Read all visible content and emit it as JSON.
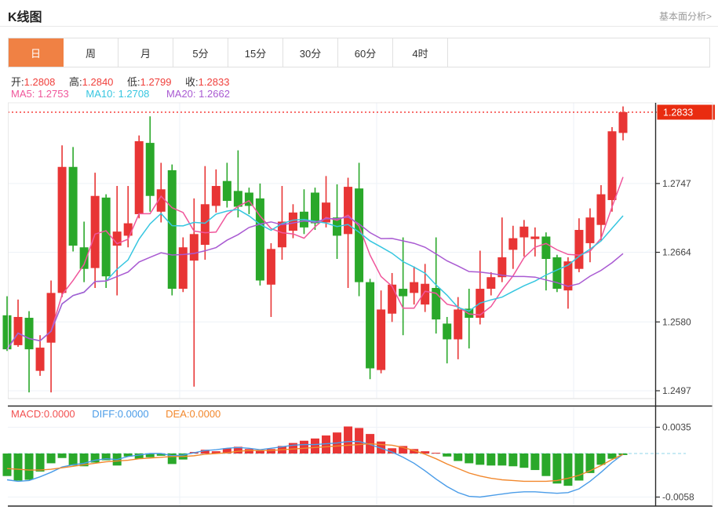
{
  "header": {
    "title": "K线图",
    "link": "基本面分析>"
  },
  "tabs": {
    "items": [
      "日",
      "周",
      "月",
      "5分",
      "15分",
      "30分",
      "60分",
      "4时"
    ],
    "active": "日"
  },
  "quote": {
    "open_label": "开:",
    "open": "1.2808",
    "high_label": "高:",
    "high": "1.2840",
    "low_label": "低:",
    "low": "1.2799",
    "close_label": "收:",
    "close": "1.2833"
  },
  "ma_header": {
    "ma5_label": "MA5:",
    "ma5": "1.2753",
    "ma10_label": "MA10:",
    "ma10": "1.2708",
    "ma20_label": "MA20:",
    "ma20": "1.2662"
  },
  "macd_header": {
    "macd_label": "MACD:",
    "macd": "0.0000",
    "diff_label": "DIFF:",
    "diff": "0.0000",
    "dea_label": "DEA:",
    "dea": "0.0000"
  },
  "colors": {
    "up": "#e83535",
    "down": "#2aa82a",
    "ma5": "#f0569b",
    "ma10": "#36c6e0",
    "ma20": "#a95ad2",
    "diff_line": "#4a9ce8",
    "dea_line": "#f2882d",
    "tag_bg": "#e92c10",
    "tag_text": "#ffffff",
    "grid": "#eef2f7",
    "axis": "#2a2a2a",
    "dotted_price_line": "#f5413d",
    "zero_dash": "#8fd4e8",
    "active_tab": "#f08144"
  },
  "chart_data": {
    "type": "candlestick",
    "title": "K线图 daily candlestick with MA5/MA10/MA20 and MACD",
    "legend": [
      "MA5",
      "MA10",
      "MA20"
    ],
    "price_axis": {
      "current": 1.2833,
      "current_label": "1.2833",
      "ticks": [
        1.2747,
        1.2664,
        1.258,
        1.2497
      ],
      "tick_labels": [
        "1.2747",
        "1.2664",
        "1.2580",
        "1.2497"
      ],
      "max": 1.2833,
      "min": 1.2497
    },
    "candles": [
      [
        1.2588,
        1.2611,
        1.2545,
        1.2547
      ],
      [
        1.2552,
        1.2607,
        1.255,
        1.2586
      ],
      [
        1.2585,
        1.2593,
        1.2495,
        1.2547
      ],
      [
        1.2521,
        1.2564,
        1.2515,
        1.2549
      ],
      [
        1.2555,
        1.263,
        1.2495,
        1.2615
      ],
      [
        1.2615,
        1.2793,
        1.261,
        1.2767
      ],
      [
        1.2767,
        1.2791,
        1.2665,
        1.2672
      ],
      [
        1.267,
        1.2701,
        1.2628,
        1.2644
      ],
      [
        1.2645,
        1.276,
        1.2621,
        1.2732
      ],
      [
        1.273,
        1.2734,
        1.2621,
        1.2635
      ],
      [
        1.2672,
        1.2744,
        1.2612,
        1.2689
      ],
      [
        1.2684,
        1.2744,
        1.267,
        1.2699
      ],
      [
        1.271,
        1.2805,
        1.2705,
        1.2798
      ],
      [
        1.2796,
        1.2828,
        1.2713,
        1.2732
      ],
      [
        1.2713,
        1.2772,
        1.27,
        1.274
      ],
      [
        1.2763,
        1.277,
        1.2612,
        1.262
      ],
      [
        1.262,
        1.2682,
        1.2616,
        1.267
      ],
      [
        1.2654,
        1.2729,
        1.2502,
        1.2686
      ],
      [
        1.2673,
        1.2768,
        1.2655,
        1.2722
      ],
      [
        1.272,
        1.2764,
        1.2712,
        1.2744
      ],
      [
        1.275,
        1.2772,
        1.2718,
        1.2726
      ],
      [
        1.2738,
        1.2787,
        1.2706,
        1.2719
      ],
      [
        1.2736,
        1.2742,
        1.271,
        1.272
      ],
      [
        1.2729,
        1.2747,
        1.2624,
        1.263
      ],
      [
        1.2625,
        1.2675,
        1.2586,
        1.2668
      ],
      [
        1.267,
        1.2744,
        1.2655,
        1.2701
      ],
      [
        1.269,
        1.2722,
        1.2681,
        1.2712
      ],
      [
        1.2713,
        1.274,
        1.2686,
        1.2694
      ],
      [
        1.2736,
        1.2742,
        1.2691,
        1.2699
      ],
      [
        1.27,
        1.2756,
        1.2694,
        1.2724
      ],
      [
        1.2706,
        1.2746,
        1.2656,
        1.2684
      ],
      [
        1.2686,
        1.2754,
        1.2621,
        1.2743
      ],
      [
        1.2741,
        1.2772,
        1.2611,
        1.2628
      ],
      [
        1.2628,
        1.2632,
        1.2511,
        1.2524
      ],
      [
        1.2522,
        1.2618,
        1.2518,
        1.2595
      ],
      [
        1.259,
        1.2639,
        1.258,
        1.2625
      ],
      [
        1.262,
        1.2682,
        1.2564,
        1.2611
      ],
      [
        1.2615,
        1.2647,
        1.2601,
        1.2628
      ],
      [
        1.2601,
        1.265,
        1.2592,
        1.2626
      ],
      [
        1.2621,
        1.2682,
        1.2566,
        1.2583
      ],
      [
        1.2578,
        1.2586,
        1.253,
        1.2559
      ],
      [
        1.2559,
        1.261,
        1.2535,
        1.2595
      ],
      [
        1.2596,
        1.262,
        1.2548,
        1.2585
      ],
      [
        1.2585,
        1.2666,
        1.2577,
        1.262
      ],
      [
        1.262,
        1.264,
        1.2612,
        1.2634
      ],
      [
        1.2634,
        1.2706,
        1.2628,
        1.2658
      ],
      [
        1.2667,
        1.2696,
        1.2644,
        1.2681
      ],
      [
        1.2682,
        1.2703,
        1.2659,
        1.2695
      ],
      [
        1.268,
        1.2694,
        1.2659,
        1.2683
      ],
      [
        1.2683,
        1.2688,
        1.2618,
        1.2656
      ],
      [
        1.2658,
        1.2661,
        1.2616,
        1.262
      ],
      [
        1.2618,
        1.2658,
        1.2596,
        1.2653
      ],
      [
        1.2644,
        1.2705,
        1.264,
        1.2691
      ],
      [
        1.2675,
        1.2717,
        1.2652,
        1.2706
      ],
      [
        1.2697,
        1.2745,
        1.2678,
        1.2734
      ],
      [
        1.2727,
        1.2815,
        1.2713,
        1.281
      ],
      [
        1.2808,
        1.284,
        1.2799,
        1.2833
      ]
    ],
    "ma_periods": [
      5,
      10,
      20
    ],
    "macd": {
      "axis_ticks": [
        0.0035,
        -0.0058
      ],
      "axis_labels": [
        "0.0035",
        "-0.0058"
      ],
      "hist": [
        -0.003,
        -0.0036,
        -0.0035,
        -0.0024,
        -0.0013,
        -0.0006,
        -0.0016,
        -0.0017,
        -0.0012,
        -0.0009,
        -0.0016,
        -0.0004,
        -0.0007,
        -0.0005,
        -0.0003,
        -0.0014,
        -0.0008,
        0.0002,
        0.0005,
        0.0003,
        0.0007,
        0.0009,
        0.0006,
        0.0004,
        0.0006,
        0.001,
        0.0014,
        0.0017,
        0.002,
        0.0024,
        0.0028,
        0.0036,
        0.0034,
        0.0026,
        0.0016,
        0.0007,
        0.001,
        0.0006,
        0.0003,
        0.0001,
        -0.0004,
        -0.001,
        -0.0013,
        -0.0015,
        -0.0016,
        -0.0016,
        -0.0017,
        -0.0019,
        -0.0022,
        -0.003,
        -0.004,
        -0.0043,
        -0.0036,
        -0.0026,
        -0.0015,
        -0.0007,
        -0.0002
      ],
      "diff": [
        -0.0035,
        -0.0037,
        -0.0036,
        -0.0031,
        -0.0025,
        -0.0018,
        -0.0015,
        -0.0013,
        -0.0009,
        -0.0007,
        -0.0008,
        -0.0004,
        -0.0002,
        0.0,
        0.0,
        -0.0003,
        -0.0002,
        0.0001,
        0.0004,
        0.0005,
        0.0007,
        0.0008,
        0.0007,
        0.0005,
        0.0007,
        0.0009,
        0.0011,
        0.0012,
        0.0012,
        0.0013,
        0.0014,
        0.0016,
        0.0016,
        0.0012,
        0.0007,
        0.0002,
        -0.0005,
        -0.0013,
        -0.0023,
        -0.0034,
        -0.0044,
        -0.0052,
        -0.0057,
        -0.0058,
        -0.0056,
        -0.0054,
        -0.0052,
        -0.0051,
        -0.0051,
        -0.0052,
        -0.0053,
        -0.0052,
        -0.0047,
        -0.0037,
        -0.0025,
        -0.0012,
        -0.0001
      ],
      "dea": [
        -0.002,
        -0.0021,
        -0.0022,
        -0.0022,
        -0.0021,
        -0.0019,
        -0.0017,
        -0.0015,
        -0.0013,
        -0.0011,
        -0.001,
        -0.0009,
        -0.0007,
        -0.0006,
        -0.0005,
        -0.0004,
        -0.0004,
        -0.0003,
        -0.0001,
        0.0,
        0.0001,
        0.0003,
        0.0004,
        0.0004,
        0.0004,
        0.0005,
        0.0006,
        0.0007,
        0.0008,
        0.0009,
        0.001,
        0.0011,
        0.0012,
        0.0013,
        0.0012,
        0.0011,
        0.0008,
        0.0004,
        -0.0001,
        -0.0007,
        -0.0014,
        -0.002,
        -0.0026,
        -0.003,
        -0.0033,
        -0.0035,
        -0.0036,
        -0.0037,
        -0.0037,
        -0.0037,
        -0.0036,
        -0.0033,
        -0.0029,
        -0.0023,
        -0.0016,
        -0.0008,
        -0.0001
      ]
    }
  }
}
